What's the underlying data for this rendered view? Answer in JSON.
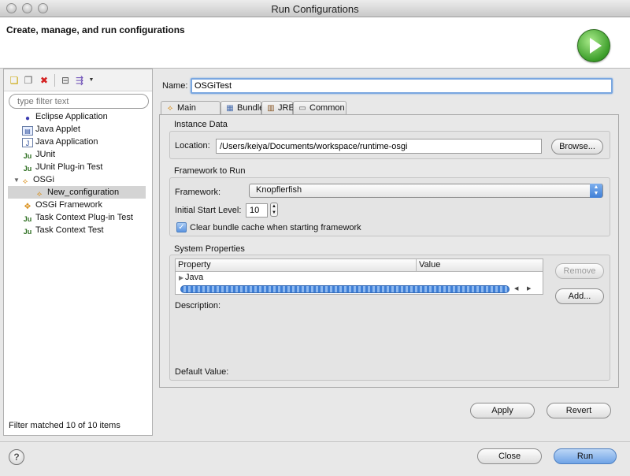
{
  "window": {
    "title": "Run Configurations"
  },
  "header": {
    "title": "Create, manage, and run configurations"
  },
  "left_panel": {
    "filter_placeholder": "type filter text",
    "tree": [
      {
        "label": "Eclipse Application",
        "icon": "eclipse-app-icon"
      },
      {
        "label": "Java Applet",
        "icon": "java-applet-icon"
      },
      {
        "label": "Java Application",
        "icon": "java-application-icon"
      },
      {
        "label": "JUnit",
        "icon": "junit-icon"
      },
      {
        "label": "JUnit Plug-in Test",
        "icon": "junit-plugin-icon"
      },
      {
        "label": "OSGi",
        "icon": "osgi-icon",
        "expanded": true
      },
      {
        "label": "New_configuration",
        "icon": "osgi-config-icon",
        "selected": true
      },
      {
        "label": "OSGi Framework",
        "icon": "osgi-framework-icon"
      },
      {
        "label": "Task Context Plug-in Test",
        "icon": "task-context-plugin-icon"
      },
      {
        "label": "Task Context Test",
        "icon": "task-context-icon"
      }
    ],
    "filter_status": "Filter matched 10 of 10 items"
  },
  "config": {
    "name_label": "Name:",
    "name_value": "OSGiTest",
    "tabs": [
      {
        "label": "Main",
        "active": true
      },
      {
        "label": "Bundles"
      },
      {
        "label": "JRE"
      },
      {
        "label": "Common"
      }
    ],
    "instance_data": {
      "title": "Instance Data",
      "location_label": "Location:",
      "location_value": "/Users/keiya/Documents/workspace/runtime-osgi",
      "browse_label": "Browse..."
    },
    "framework": {
      "title": "Framework to Run",
      "framework_label": "Framework:",
      "framework_value": "Knopflerfish",
      "start_level_label": "Initial Start Level:",
      "start_level_value": "10",
      "clear_cache_label": "Clear bundle cache when starting framework",
      "clear_cache_checked": true
    },
    "system_properties": {
      "title": "System Properties",
      "col_property": "Property",
      "col_value": "Value",
      "rows": [
        "Java"
      ],
      "remove_label": "Remove",
      "add_label": "Add...",
      "description_label": "Description:",
      "default_value_label": "Default Value:"
    },
    "apply_label": "Apply",
    "revert_label": "Revert"
  },
  "footer": {
    "close_label": "Close",
    "run_label": "Run",
    "help_glyph": "?"
  }
}
